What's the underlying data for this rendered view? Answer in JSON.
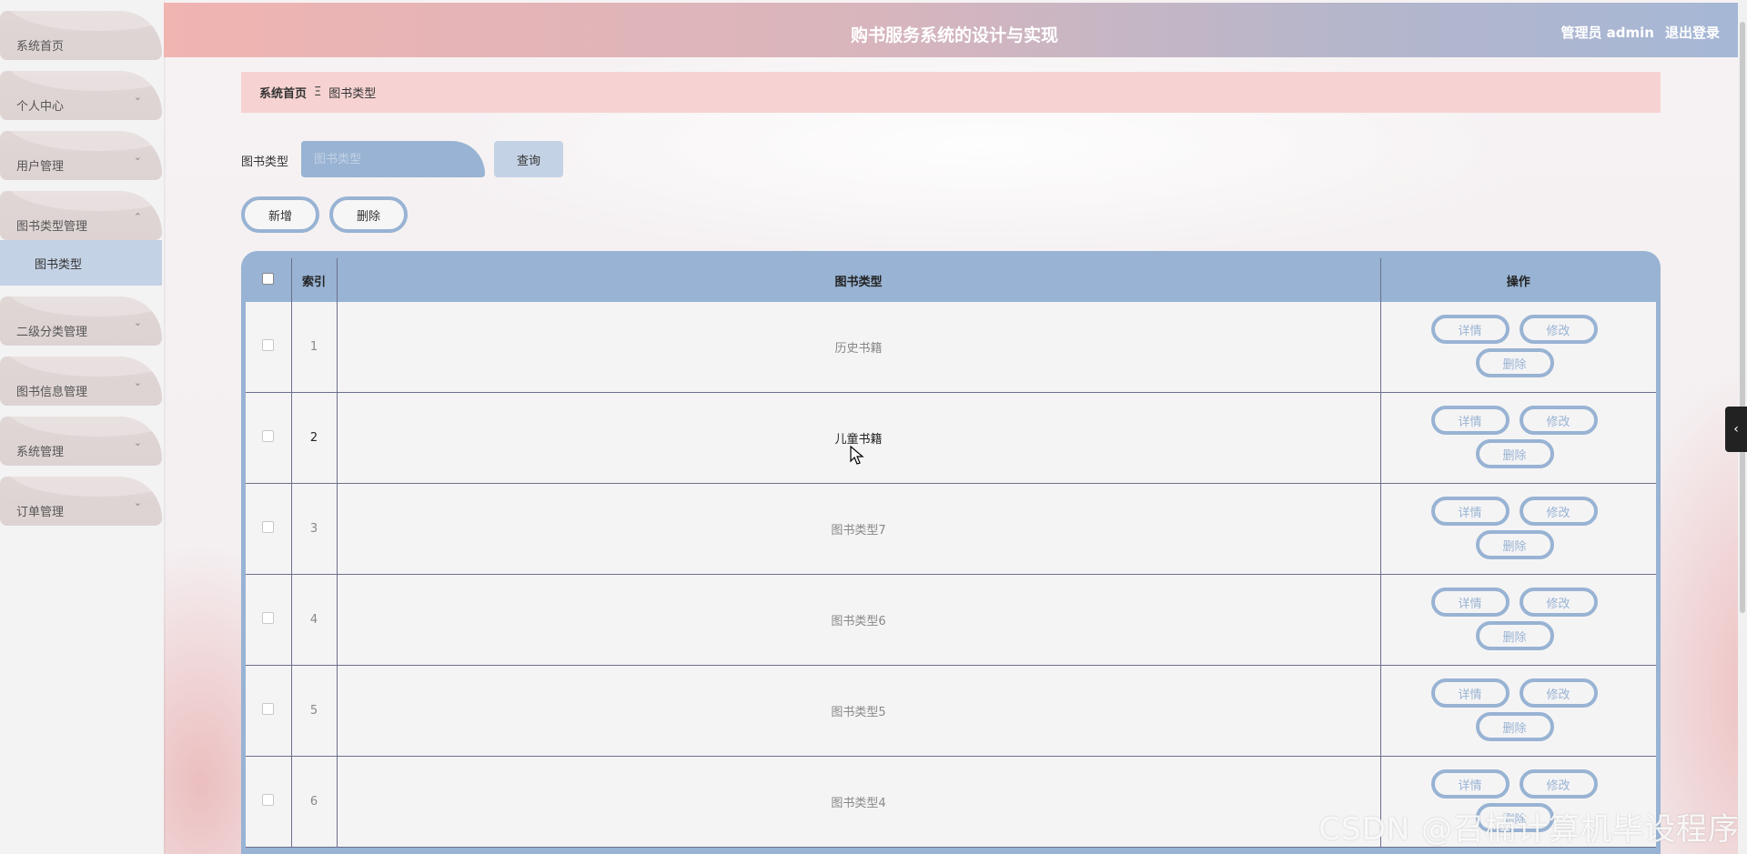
{
  "header": {
    "title": "购书服务系统的设计与实现",
    "user": "管理员 admin",
    "logout": "退出登录"
  },
  "sidebar": {
    "items": [
      {
        "label": "系统首页",
        "chevron": ""
      },
      {
        "label": "个人中心",
        "chevron": "⌄"
      },
      {
        "label": "用户管理",
        "chevron": "⌄"
      },
      {
        "label": "图书类型管理",
        "chevron": "⌃"
      },
      {
        "label": "二级分类管理",
        "chevron": "⌄"
      },
      {
        "label": "图书信息管理",
        "chevron": "⌄"
      },
      {
        "label": "系统管理",
        "chevron": "⌄"
      },
      {
        "label": "订单管理",
        "chevron": "⌄"
      }
    ],
    "active_sub": "图书类型"
  },
  "breadcrumb": {
    "home": "系统首页",
    "separator": "Ξ",
    "current": "图书类型"
  },
  "search": {
    "label": "图书类型",
    "placeholder": "图书类型",
    "button": "查询"
  },
  "actions": {
    "add": "新增",
    "delete": "删除"
  },
  "table": {
    "headers": {
      "index": "索引",
      "type": "图书类型",
      "ops": "操作"
    },
    "rows": [
      {
        "index": "1",
        "type": "历史书籍"
      },
      {
        "index": "2",
        "type": "儿童书籍"
      },
      {
        "index": "3",
        "type": "图书类型7"
      },
      {
        "index": "4",
        "type": "图书类型6"
      },
      {
        "index": "5",
        "type": "图书类型5"
      },
      {
        "index": "6",
        "type": "图书类型4"
      }
    ],
    "op_labels": {
      "detail": "详情",
      "edit": "修改",
      "delete": "删除"
    }
  },
  "side_tab": "‹",
  "watermark": "CSDN @召楠计算机毕设程序",
  "colors": {
    "accent_blue": "#98b3d3",
    "light_blue": "#c4d2e5",
    "breadcrumb_pink": "#f6d3d2",
    "menu_item": "#e0d6d5"
  }
}
